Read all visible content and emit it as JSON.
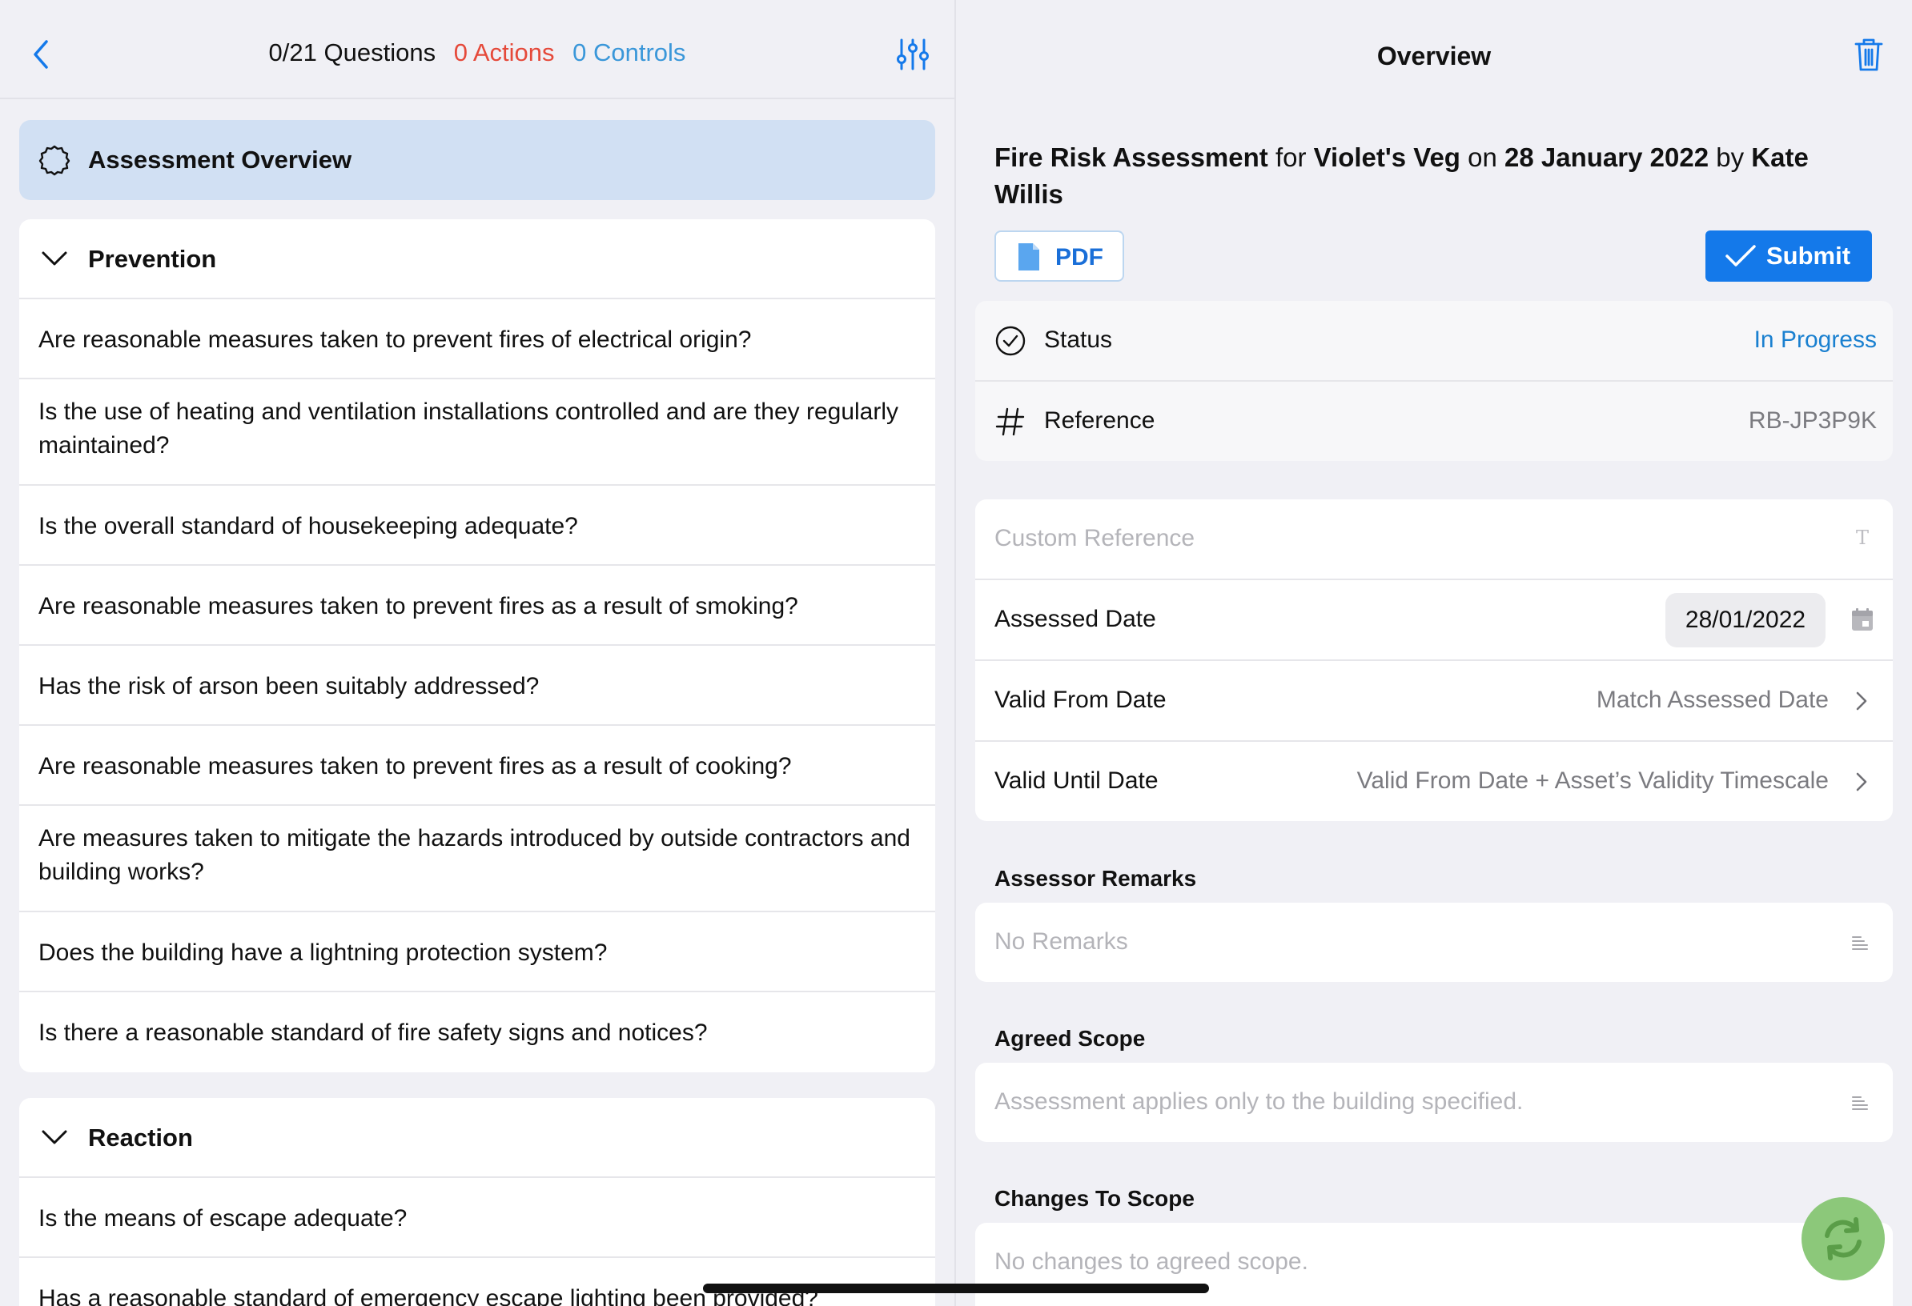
{
  "left_header": {
    "questions": "0/21 Questions",
    "actions": "0 Actions",
    "controls": "0 Controls"
  },
  "overview_item": {
    "label": "Assessment Overview"
  },
  "sections": [
    {
      "title": "Prevention",
      "questions": [
        "Are reasonable measures taken to prevent fires of electrical origin?",
        "Is the use of heating and ventilation installations controlled and are they regularly maintained?",
        "Is the overall standard of housekeeping adequate?",
        "Are reasonable measures taken to prevent fires as a result of smoking?",
        "Has the risk of arson been suitably addressed?",
        "Are reasonable measures taken to prevent fires as a result of cooking?",
        "Are measures taken to mitigate the hazards introduced by outside contractors and building works?",
        "Does the building have a lightning protection system?",
        "Is there a reasonable standard of fire safety signs and notices?"
      ]
    },
    {
      "title": "Reaction",
      "questions": [
        "Is the means of escape adequate?",
        "Has a reasonable standard of emergency escape lighting been provided?"
      ]
    }
  ],
  "right_header": {
    "title": "Overview"
  },
  "assessment": {
    "type": "Fire Risk Assessment",
    "for_word": "for",
    "site": "Violet's Veg",
    "on_word": "on",
    "date": "28 January 2022",
    "by_word": "by",
    "assessor": "Kate Willis"
  },
  "buttons": {
    "pdf": "PDF",
    "submit": "Submit"
  },
  "status_card": {
    "status_label": "Status",
    "status_value": "In Progress",
    "reference_label": "Reference",
    "reference_value": "RB-JP3P9K"
  },
  "details_card": {
    "custom_reference_placeholder": "Custom Reference",
    "assessed_date_label": "Assessed Date",
    "assessed_date_value": "28/01/2022",
    "valid_from_label": "Valid From Date",
    "valid_from_value": "Match Assessed Date",
    "valid_until_label": "Valid Until Date",
    "valid_until_value": "Valid From Date + Asset’s Validity Timescale"
  },
  "remarks": {
    "label": "Assessor Remarks",
    "placeholder": "No Remarks"
  },
  "agreed_scope": {
    "label": "Agreed Scope",
    "placeholder": "Assessment applies only to the building specified."
  },
  "changes_scope": {
    "label": "Changes To Scope",
    "placeholder": "No changes to agreed scope."
  },
  "colors": {
    "accent": "#1479ea",
    "actions": "#e5493a",
    "controls": "#3a97d9",
    "selected": "#d1e0f3",
    "sync": "#8cc87a"
  }
}
